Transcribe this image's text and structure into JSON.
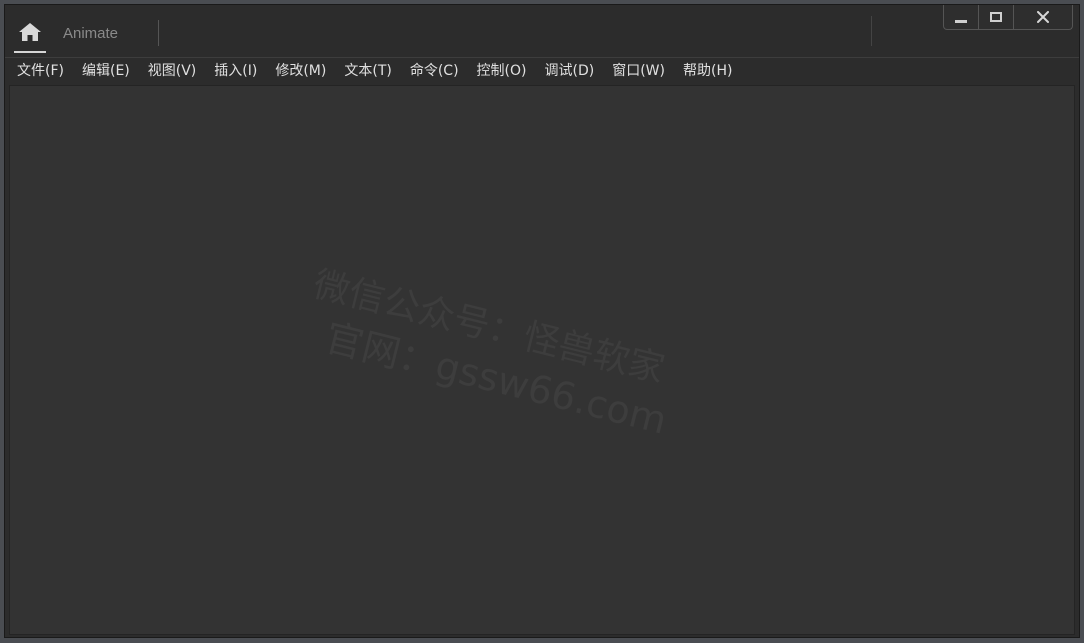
{
  "app": {
    "title": "Animate"
  },
  "window_controls": {
    "close_glyph": "✕"
  },
  "menu": {
    "items": [
      {
        "label": "文件(F)"
      },
      {
        "label": "编辑(E)"
      },
      {
        "label": "视图(V)"
      },
      {
        "label": "插入(I)"
      },
      {
        "label": "修改(M)"
      },
      {
        "label": "文本(T)"
      },
      {
        "label": "命令(C)"
      },
      {
        "label": "控制(O)"
      },
      {
        "label": "调试(D)"
      },
      {
        "label": "窗口(W)"
      },
      {
        "label": "帮助(H)"
      }
    ]
  },
  "watermark": {
    "line1": "微信公众号：怪兽软家",
    "line2": "官网：gssw66.com"
  },
  "icons": {
    "home": "home-icon",
    "minimize": "minimize-icon",
    "maximize": "maximize-icon",
    "close": "close-icon"
  },
  "colors": {
    "window_bg": "#2c2c2c",
    "stage_bg": "#333333",
    "menu_text": "#e0e0e0",
    "title_text": "#8a8a8a"
  }
}
